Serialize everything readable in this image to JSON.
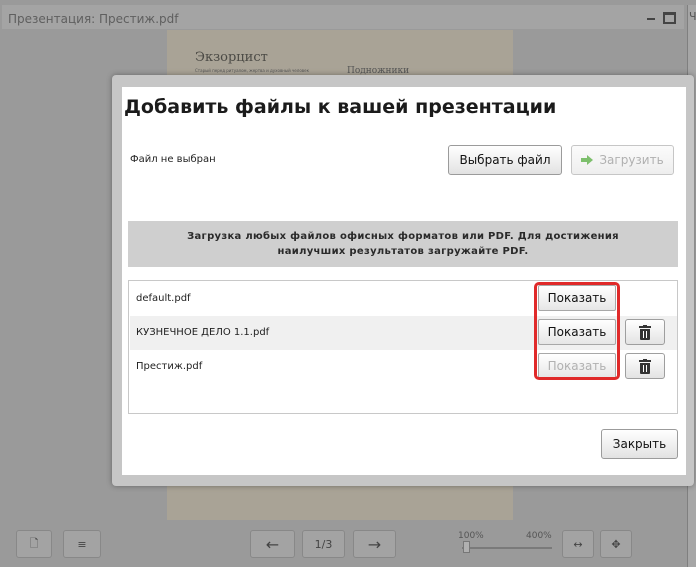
{
  "background": {
    "window_title": "Презентация: Престиж.pdf",
    "right_panel_text": "Ч",
    "slide": {
      "title": "Экзорцист",
      "subtitle": "Старый перед ритуалом, жертва и духовный человек",
      "side_heading": "Подножники"
    },
    "toolbar": {
      "page_indicator": "1/3",
      "zoom_min_label": "100%",
      "zoom_max_label": "400%"
    }
  },
  "dialog": {
    "title": "Добавить файлы к вашей презентации",
    "file_status": "Файл не выбран",
    "choose_button": "Выбрать файл",
    "upload_button": "Загрузить",
    "info": "Загрузка любых файлов офисных форматов или PDF. Для достижения наилучших результатов загружайте PDF.",
    "files": [
      {
        "name": "default.pdf",
        "show_label": "Показать",
        "show_enabled": true,
        "deletable": false
      },
      {
        "name": "КУЗНЕЧНОЕ ДЕЛО 1.1.pdf",
        "show_label": "Показать",
        "show_enabled": true,
        "deletable": true
      },
      {
        "name": "Престиж.pdf",
        "show_label": "Показать",
        "show_enabled": false,
        "deletable": true
      }
    ],
    "close_button": "Закрыть"
  },
  "colors": {
    "highlight": "#e02a2a",
    "upload_arrow": "#7dbf6c"
  },
  "icons": {
    "upload": "arrow-right-icon",
    "delete": "trash-icon"
  }
}
